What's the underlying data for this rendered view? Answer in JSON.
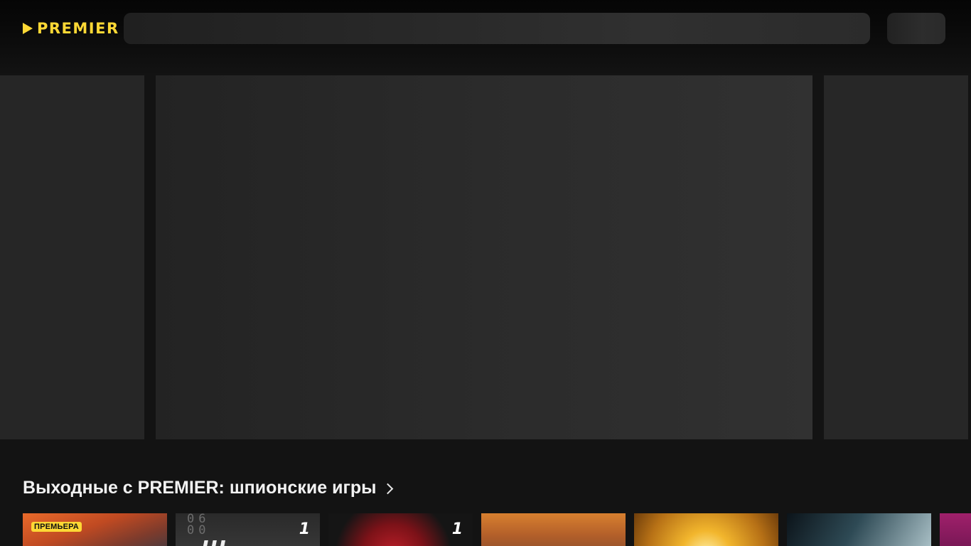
{
  "brand": {
    "name": "PREMIER",
    "accent_color": "#fdd835"
  },
  "section": {
    "title": "Выходные с PREMIER: шпионские игры",
    "chevron_icon": "chevron-right-icon"
  },
  "cards": [
    {
      "badge": "ПРЕМЬЕРА"
    },
    {
      "channel_logo": "1",
      "title_fragment": "Ш",
      "digits": "06\n00"
    },
    {
      "channel_logo": "1"
    },
    {},
    {},
    {},
    {}
  ]
}
